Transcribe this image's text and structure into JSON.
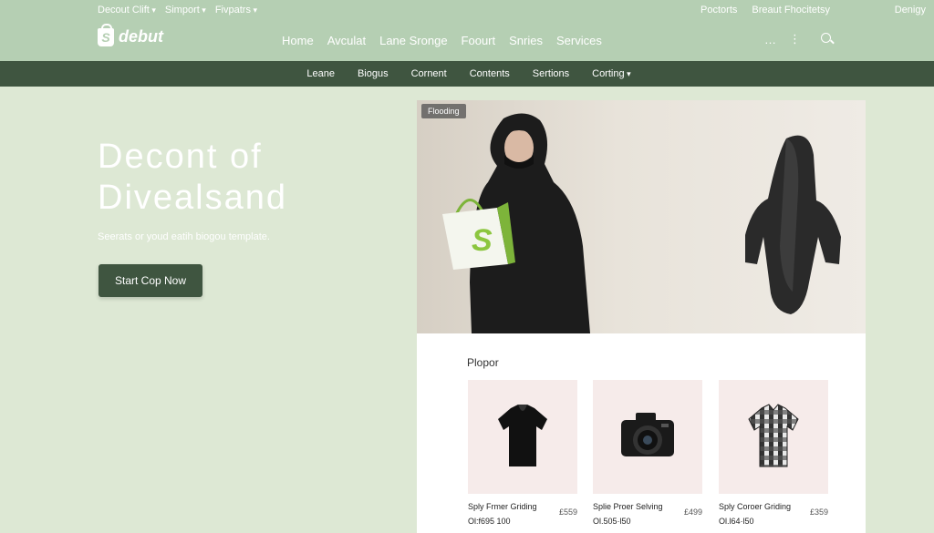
{
  "utility_left": [
    "Decout Clift",
    "Simport",
    "Fivpatrs"
  ],
  "utility_right": [
    "Poctorts",
    "Breaut Fhocitetsy",
    "Denigy"
  ],
  "logo": {
    "text": "debut",
    "glyph": "S"
  },
  "main_nav": [
    "Home",
    "Avculat",
    "Lane Sronge",
    "Foourt",
    "Snries",
    "Services"
  ],
  "header_icons": {
    "more": "…",
    "kebab": "⋮"
  },
  "subnav": [
    "Leane",
    "Biogus",
    "Cornent",
    "Contents",
    "Sertions",
    "Corting"
  ],
  "hero": {
    "title_line1": "Decont of",
    "title_line2": "Divealsand",
    "subtitle": "Seerats or youd eatih biogou template.",
    "cta_label": "Start Cop Now"
  },
  "banner": {
    "tag": "Flooding",
    "bag_glyph": "S"
  },
  "products_section": {
    "title": "Plopor",
    "items": [
      {
        "name": "Sply Frmer Griding",
        "price": "£559",
        "code": "Ol:f695 100",
        "icon": "tshirt-icon"
      },
      {
        "name": "Splie Proer Selving",
        "price": "£499",
        "code": "Ol.505·l50",
        "icon": "camera-icon"
      },
      {
        "name": "Sply Coroer Griding",
        "price": "£359",
        "code": "Ol.l64·l50",
        "icon": "shirt-icon"
      }
    ]
  },
  "colors": {
    "header": "#b5cfb3",
    "subnav": "#3f5540",
    "page": "#dde8d4",
    "accent_green": "#8cc63f"
  }
}
